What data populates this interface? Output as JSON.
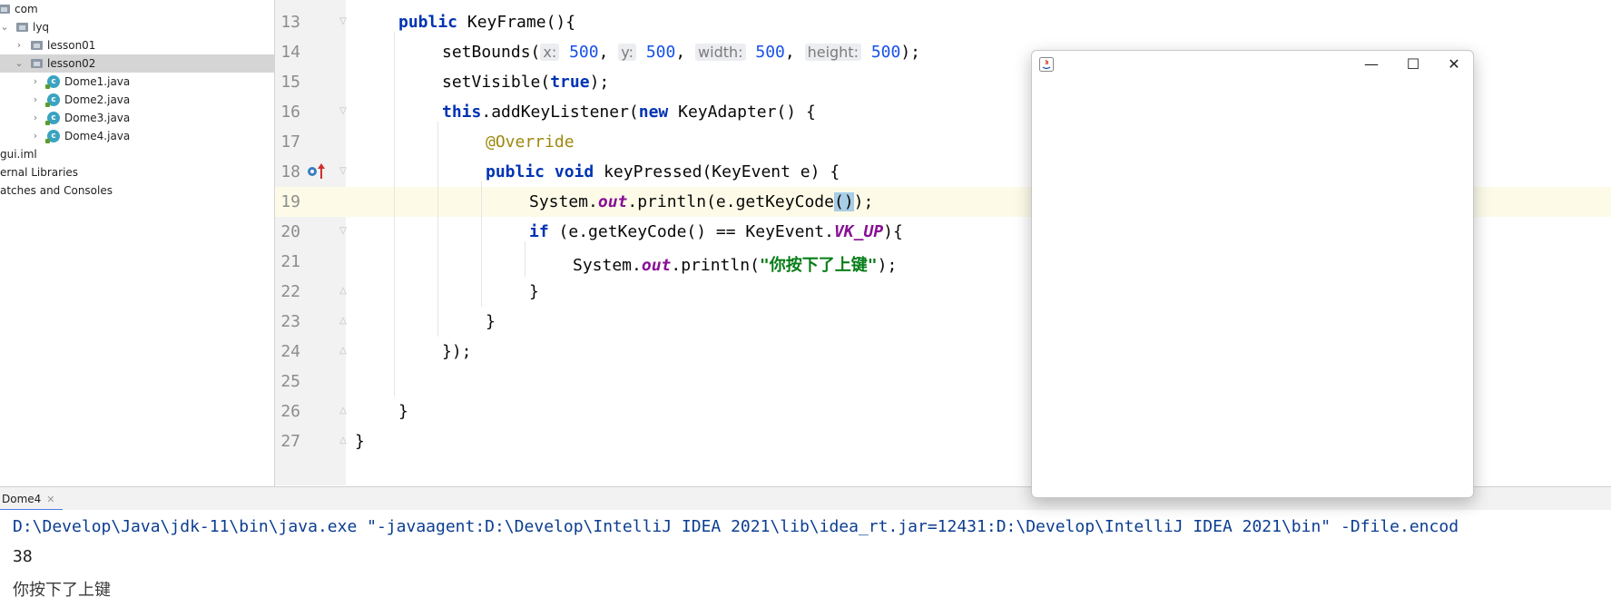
{
  "project_tree": {
    "items": [
      {
        "label": "com",
        "kind": "folder",
        "expanded": true
      },
      {
        "label": "lyq",
        "kind": "folder",
        "expanded": true
      },
      {
        "label": "lesson01",
        "kind": "folder",
        "expanded": false
      },
      {
        "label": "lesson02",
        "kind": "folder",
        "expanded": true,
        "selected": true
      },
      {
        "label": "Dome1.java",
        "kind": "class"
      },
      {
        "label": "Dome2.java",
        "kind": "class"
      },
      {
        "label": "Dome3.java",
        "kind": "class"
      },
      {
        "label": "Dome4.java",
        "kind": "class"
      },
      {
        "label": "gui.iml",
        "kind": "file"
      },
      {
        "label": "ernal Libraries",
        "kind": "library"
      },
      {
        "label": "atches and Consoles",
        "kind": "scratch"
      }
    ]
  },
  "editor": {
    "current_line": 19,
    "line_numbers": [
      "13",
      "14",
      "15",
      "16",
      "17",
      "18",
      "19",
      "20",
      "21",
      "22",
      "23",
      "24",
      "25",
      "26",
      "27"
    ],
    "code": {
      "l13_kw": "public",
      "l13_rest": " KeyFrame(){",
      "l14_call": "setBounds(",
      "l14_hint_x": "x:",
      "l14_val_x": "500",
      "l14_hint_y": "y:",
      "l14_val_y": "500",
      "l14_hint_w": "width:",
      "l14_val_w": "500",
      "l14_hint_h": "height:",
      "l14_val_h": "500",
      "l14_end": ");",
      "l15_call": "setVisible(",
      "l15_kw": "true",
      "l15_end": ");",
      "l16_kw1": "this",
      "l16_mid": ".addKeyListener(",
      "l16_kw2": "new",
      "l16_rest": " KeyAdapter() {",
      "l17_ann": "@Override",
      "l18_kw1": "public",
      "l18_kw2": "void",
      "l18_rest": " keyPressed(KeyEvent e) {",
      "l19_a": "System.",
      "l19_fld": "out",
      "l19_b": ".println(e.getKeyCode",
      "l19_paren": "()",
      "l19_end": ");",
      "l20_kw": "if",
      "l20_mid": " (e.getKeyCode() == KeyEvent.",
      "l20_fld": "VK_UP",
      "l20_end": "){",
      "l21_a": "System.",
      "l21_fld": "out",
      "l21_b": ".println(",
      "l21_str": "\"你按下了上键\"",
      "l21_end": ");",
      "l22": "}",
      "l23": "}",
      "l24": "});",
      "l26": "}",
      "l27": "}"
    }
  },
  "run_panel": {
    "tab_label": "Dome4",
    "command": "D:\\Develop\\Java\\jdk-11\\bin\\java.exe \"-javaagent:D:\\Develop\\IntelliJ IDEA 2021\\lib\\idea_rt.jar=12431:D:\\Develop\\IntelliJ IDEA 2021\\bin\" -Dfile.encod",
    "output_lines": [
      "38",
      "你按下了上键"
    ]
  },
  "java_window": {
    "icon": "java-icon",
    "minimize_glyph": "—",
    "maximize_glyph": "☐",
    "close_glyph": "✕"
  },
  "colors": {
    "keyword": "#0033b3",
    "number": "#1750eb",
    "string": "#067d17",
    "field": "#871094",
    "annotation": "#9e880d",
    "command_text": "#0b3d91"
  }
}
